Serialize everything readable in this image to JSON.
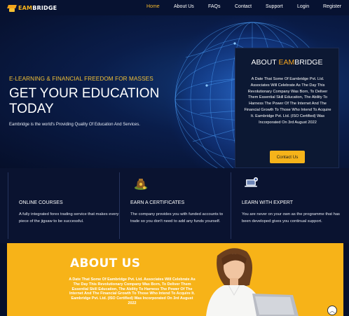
{
  "brand": {
    "logo_prefix": "EAM",
    "logo_suffix": "BRIDGE"
  },
  "nav": {
    "items": [
      {
        "label": "Home",
        "active": true
      },
      {
        "label": "About Us",
        "active": false
      },
      {
        "label": "FAQs",
        "active": false
      },
      {
        "label": "Contact",
        "active": false
      },
      {
        "label": "Support",
        "active": false
      },
      {
        "label": "Login",
        "active": false
      },
      {
        "label": "Register",
        "active": false
      }
    ]
  },
  "hero": {
    "tagline": "E-LEARNING & FINANCIAL FREEDOM FOR MASSES",
    "title_line1": "GET YOUR EDUCATION",
    "title_line2": "TODAY",
    "subtitle": "Eambridge is the world's Providing Quality Of Education And Services."
  },
  "about_card": {
    "title_prefix": "ABOUT ",
    "title_highlight": "EAM",
    "title_suffix": "BRIDGE",
    "text": "A Date That Some Of Eambridge Pvt. Ltd. Associates Will Celebrate As The Day This Revolutionary Company Was Born, To Deliver Them Essential Skill Education, The Ability To Harness The Power Of The Internet And The Financial Growth To Those Who Intend To Acquire It. Eambridge Pvt. Ltd. (ISO Certified) Was Incorporated On 3rd August 2022",
    "button_label": "Contact Us"
  },
  "features": [
    {
      "icon": "graduate-icon",
      "title": "ONLINE COURSES",
      "text": "A fully integrated forex trading service that makes every piece of the jigsaw to be successful."
    },
    {
      "icon": "money-bag-icon",
      "title": "EARN A CERTIFICATES",
      "text": "The company provides you with funded accounts to trade so you don't need to add any funds yourself."
    },
    {
      "icon": "laptop-icon",
      "title": "LEARN WITH EXPERT",
      "text": "You are never on your own as the programme that has been developed gives you continual support."
    }
  ],
  "about_section": {
    "title": "ABOUT US",
    "text": "A Date That Some Of Eambridge Pvt. Ltd. Associates Will Celebrate As The Day This Revolutionary Company Was Born, To Deliver Them Essential Skill Education, The Ability To Harness The Power Of The Internet And The Financial Growth To Those Who Intend To Acquire It. Eambridge Pvt. Ltd. (ISO Certified) Was Incorporated On 3rd August 2022"
  },
  "colors": {
    "accent": "#f5b31a",
    "navy": "#06102a",
    "nav_active": "#f6b92c"
  }
}
